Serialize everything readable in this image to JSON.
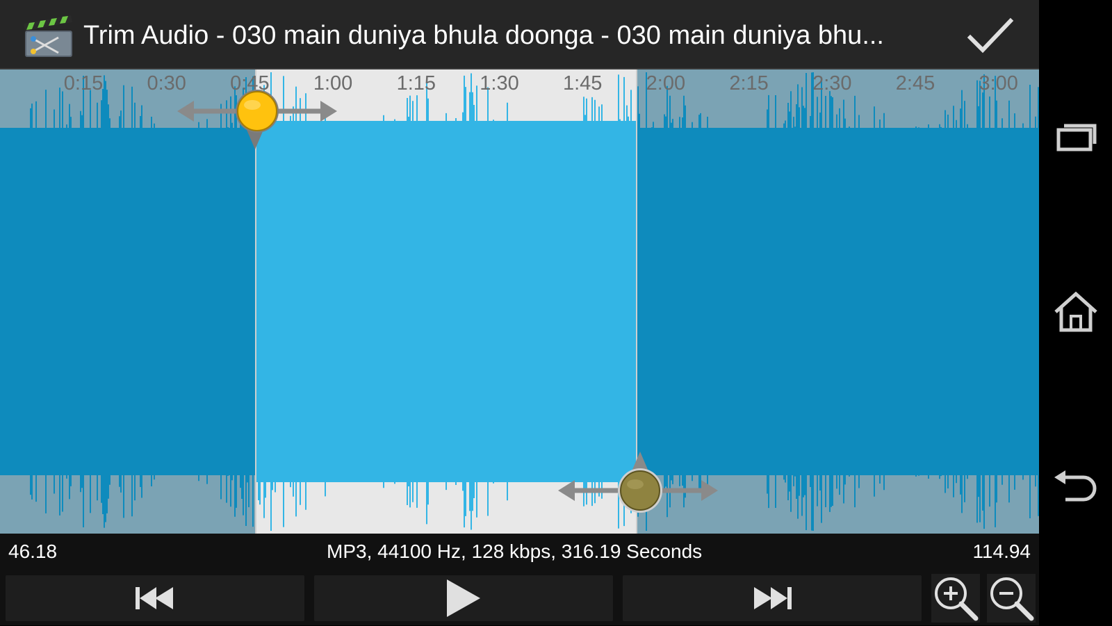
{
  "action_bar": {
    "app_icon": "clapperboard-scissors-icon",
    "title": "Trim Audio - 030 main duniya bhula doonga - 030 main duniya bhu...",
    "done_icon": "checkmark-icon"
  },
  "timeline": {
    "ticks": [
      "0:15",
      "0:30",
      "0:45",
      "1:00",
      "1:15",
      "1:30",
      "1:45",
      "2:00",
      "2:15",
      "2:30",
      "2:45",
      "3:00"
    ],
    "start_marker_color": "#ffc20e",
    "end_marker_color": "#8f8340"
  },
  "info_bar": {
    "start_time": "46.18",
    "file_info": "MP3, 44100 Hz, 128 kbps, 316.19 Seconds",
    "end_time": "114.94"
  },
  "controls": {
    "rewind_icon": "skip-back-icon",
    "play_icon": "play-icon",
    "forward_icon": "skip-forward-icon",
    "zoom_in_icon": "zoom-in-icon",
    "zoom_out_icon": "zoom-out-icon"
  },
  "system_nav": {
    "recents_icon": "recents-icon",
    "home_icon": "home-icon",
    "back_icon": "back-icon"
  },
  "colors": {
    "waveform_selected": "#33b5e5",
    "waveform_unselected": "#0e8bbd",
    "background_selected": "#e8e8e8",
    "background_unselected": "#7ba3b4"
  }
}
